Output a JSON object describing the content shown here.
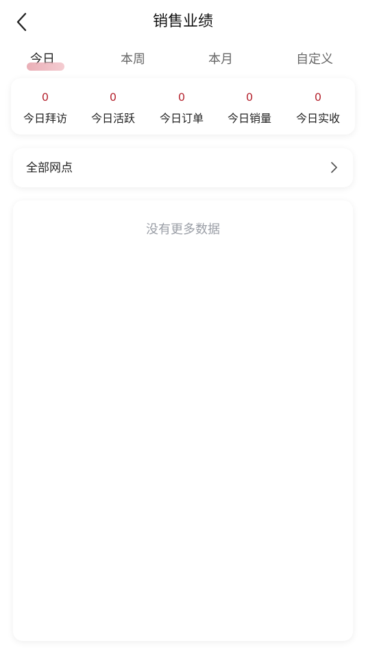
{
  "header": {
    "title": "销售业绩",
    "back_icon": "chevron-left-icon"
  },
  "tabs": [
    {
      "label": "今日",
      "active": true
    },
    {
      "label": "本周",
      "active": false
    },
    {
      "label": "本月",
      "active": false
    },
    {
      "label": "自定义",
      "active": false
    }
  ],
  "colors": {
    "accent_value": "#b5242f",
    "indicator": "#e6a1aa",
    "empty_text": "#9a9ea6"
  },
  "stats": [
    {
      "value": "0",
      "label": "今日拜访"
    },
    {
      "value": "0",
      "label": "今日活跃"
    },
    {
      "value": "0",
      "label": "今日订单"
    },
    {
      "value": "0",
      "label": "今日销量"
    },
    {
      "value": "0",
      "label": "今日实收"
    }
  ],
  "branch_selector": {
    "label": "全部网点",
    "icon": "chevron-right-icon"
  },
  "list": {
    "empty_text": "没有更多数据"
  }
}
